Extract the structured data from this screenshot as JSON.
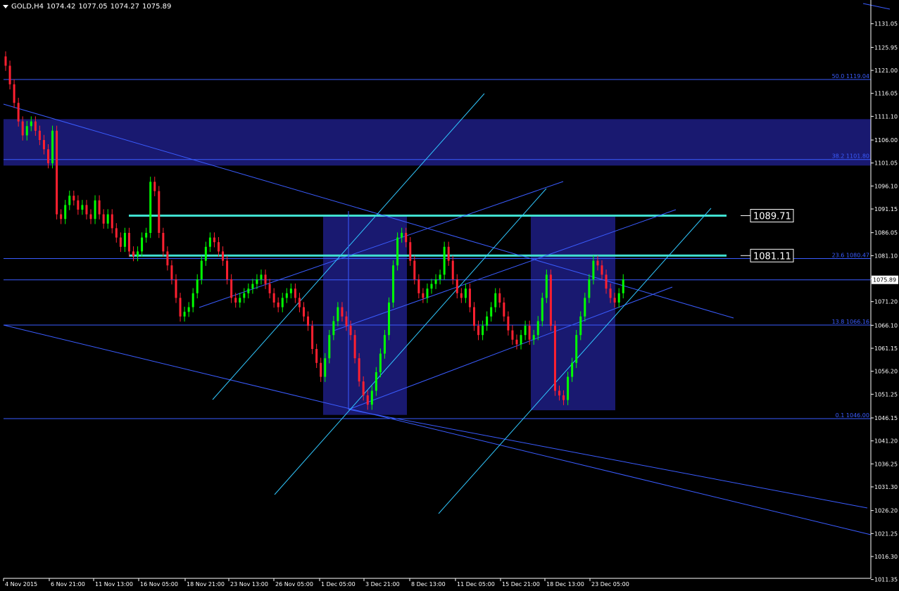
{
  "header": {
    "symbol": "GOLD,H4",
    "open": "1074.42",
    "high": "1077.05",
    "low": "1074.27",
    "close": "1075.89"
  },
  "colors": {
    "background": "#000000",
    "bull": "#00ff00",
    "bear": "#ff2030",
    "trendline": "#3a5cff",
    "pitchfork": "#30c8ff",
    "level": "#40e0d0",
    "zone": "#191970",
    "price_tag": "#ffffff"
  },
  "chart_data": {
    "type": "candlestick",
    "symbol": "GOLD",
    "timeframe": "H4",
    "ylim": [
      1011.6,
      1135.4
    ],
    "y_ticks": [
      "1131.05",
      "1125.95",
      "1121.00",
      "1116.05",
      "1111.10",
      "1106.00",
      "1101.05",
      "1096.10",
      "1091.15",
      "1086.05",
      "1081.10",
      "1076.15",
      "1071.20",
      "1066.10",
      "1061.15",
      "1056.20",
      "1051.25",
      "1046.15",
      "1041.20",
      "1036.25",
      "1031.30",
      "1026.20",
      "1021.25",
      "1016.30",
      "1011.35"
    ],
    "x_ticks": [
      "4 Nov 2015",
      "6 Nov 21:00",
      "11 Nov 13:00",
      "16 Nov 05:00",
      "18 Nov 21:00",
      "23 Nov 13:00",
      "26 Nov 05:00",
      "1 Dec 05:00",
      "3 Dec 21:00",
      "8 Dec 13:00",
      "11 Dec 05:00",
      "15 Dec 21:00",
      "18 Dec 13:00",
      "23 Dec 05:00"
    ],
    "bar_count": 145,
    "closes": [
      1122,
      1118,
      1114,
      1110,
      1107,
      1109,
      1110,
      1108,
      1106,
      1104,
      1101,
      1108,
      1090,
      1089,
      1092,
      1094,
      1093,
      1091,
      1092,
      1090,
      1089,
      1093,
      1090,
      1088,
      1090,
      1087,
      1085,
      1083,
      1086,
      1082,
      1081,
      1082,
      1085,
      1086,
      1097,
      1095,
      1086,
      1082,
      1079,
      1076,
      1072,
      1068,
      1069,
      1070,
      1073,
      1076,
      1080,
      1083,
      1085,
      1084,
      1082,
      1080,
      1076,
      1072,
      1071,
      1072,
      1073,
      1074,
      1075,
      1076,
      1077,
      1075,
      1073,
      1071,
      1070,
      1072,
      1073,
      1074,
      1072,
      1070,
      1068,
      1066,
      1061,
      1058,
      1055,
      1059,
      1064,
      1067,
      1070,
      1068,
      1066,
      1064,
      1059,
      1054,
      1051,
      1049,
      1052,
      1056,
      1060,
      1064,
      1071,
      1079,
      1085,
      1086,
      1084,
      1080,
      1076,
      1073,
      1072,
      1074,
      1075,
      1076,
      1077,
      1083,
      1080,
      1076,
      1073,
      1072,
      1074,
      1070,
      1066,
      1064,
      1066,
      1068,
      1070,
      1073,
      1071,
      1068,
      1065,
      1063,
      1062,
      1064,
      1066,
      1063,
      1064,
      1067,
      1072,
      1077,
      1066,
      1052,
      1051,
      1050,
      1055,
      1058,
      1064,
      1068,
      1072,
      1076,
      1080,
      1079,
      1077,
      1074,
      1072,
      1071,
      1073,
      1076
    ],
    "fib_levels": [
      {
        "label": "50.0 1119.04",
        "price": 1119.04
      },
      {
        "label": "38.2 1101.80",
        "price": 1101.8
      },
      {
        "label": "23.6 1080.47",
        "price": 1080.47
      },
      {
        "label": "13.8 1066.16",
        "price": 1066.16
      },
      {
        "label": "0.1 1046.00",
        "price": 1046.0
      }
    ],
    "price_levels": [
      {
        "label": "1089.71",
        "price": 1089.71
      },
      {
        "label": "1081.11",
        "price": 1081.11
      }
    ],
    "current_price": {
      "label": "1075.89",
      "price": 1075.89
    },
    "zones": [
      {
        "from": 1100.5,
        "to": 1110.5
      },
      {
        "from": 1046.8,
        "to": 1089.5
      },
      {
        "from": 1047.8,
        "to": 1089.8
      }
    ]
  }
}
